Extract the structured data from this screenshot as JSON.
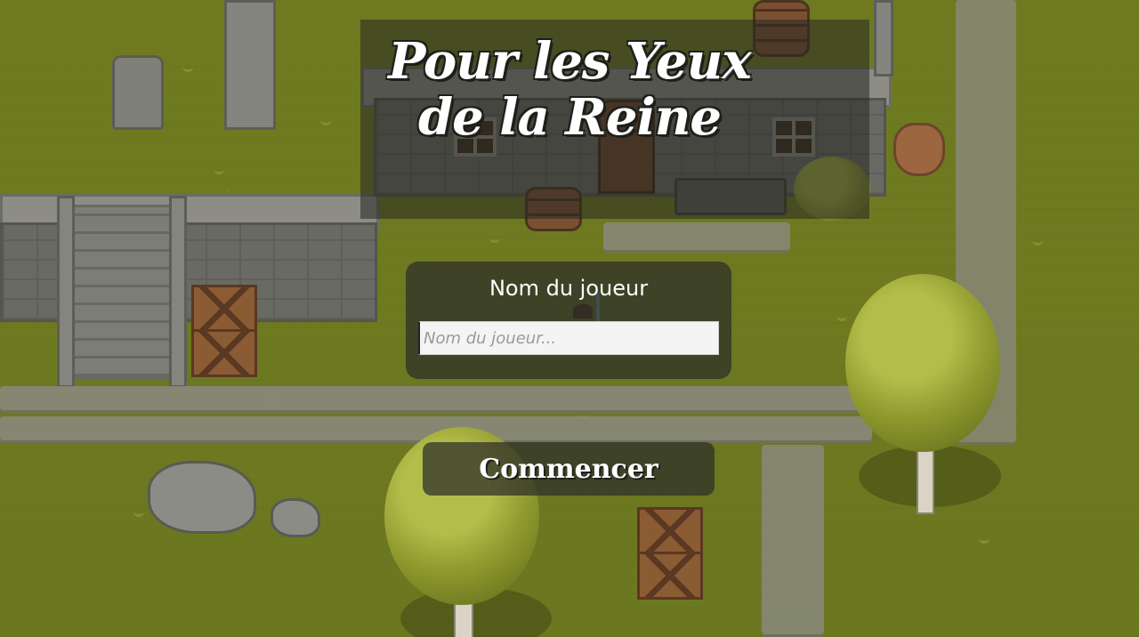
{
  "game": {
    "title_line1": "Pour les Yeux",
    "title_line2": "de la Reine"
  },
  "login": {
    "label": "Nom du joueur",
    "input_placeholder": "Nom du joueur...",
    "input_value": ""
  },
  "actions": {
    "start_label": "Commencer"
  },
  "colors": {
    "grass": "#6f7a20",
    "panel_overlay": "rgba(45,45,40,0.72)",
    "text": "#ffffff"
  }
}
